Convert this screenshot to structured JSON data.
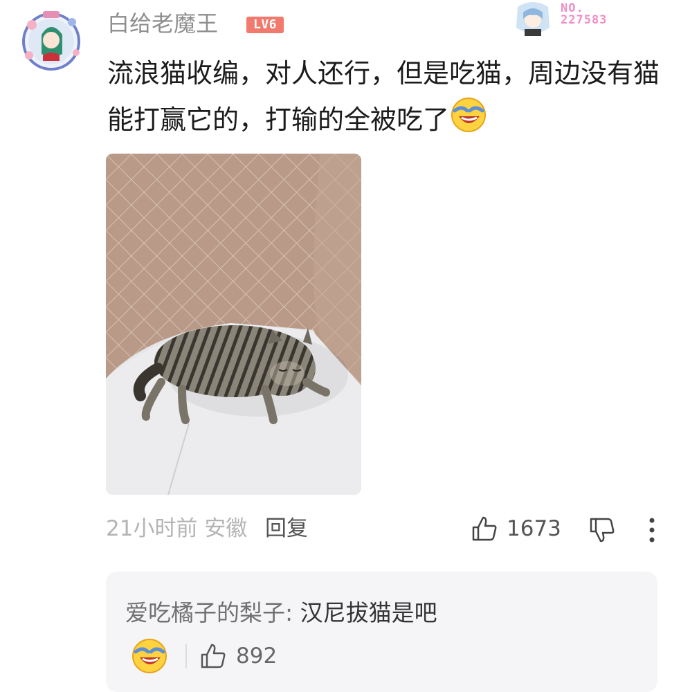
{
  "comment": {
    "username": "白给老魔王",
    "level_badge": "LV6",
    "fan_badge_no": "NO.\n227583",
    "text": "流浪猫收编，对人还行，但是吃猫，周边没有猫能打赢它的，打输的全被吃了",
    "emoji": "laughing-crying-emoji",
    "time": "21小时前",
    "location": "安徽",
    "reply_label": "回复",
    "like_count": "1673"
  },
  "reply": {
    "author": "爱吃橘子的梨子",
    "separator": ": ",
    "text": "汉尼拔猫是吧",
    "like_count": "892"
  },
  "colors": {
    "level_badge": "#f07a6e",
    "fan_no": "#f08fc6",
    "reply_bg": "#f5f5f7",
    "meta_gray": "#b4b4b4"
  }
}
